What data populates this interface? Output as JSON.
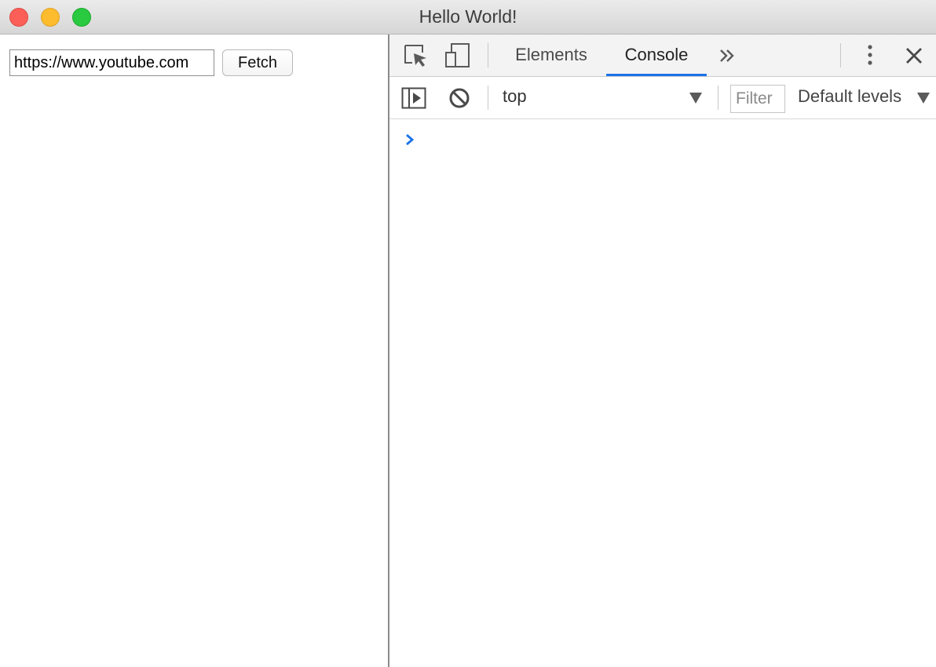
{
  "window": {
    "title": "Hello World!"
  },
  "app": {
    "url_input_value": "https://www.youtube.com",
    "fetch_button_label": "Fetch"
  },
  "devtools": {
    "tabs": [
      {
        "label": "Elements"
      },
      {
        "label": "Console",
        "active": true
      }
    ],
    "more_tabs_label": "»",
    "console_toolbar": {
      "context": "top",
      "filter_placeholder": "Filter",
      "levels": "Default levels"
    },
    "prompt_symbol": "›"
  },
  "colors": {
    "close": "#fc5f57",
    "minimize": "#fdbc2e",
    "maximize": "#29c940",
    "active_tab_underline": "#1a73e8",
    "prompt": "#1a73e8"
  },
  "icons": [
    "inspect-element-icon",
    "device-toggle-icon",
    "more-tabs-icon",
    "kebab-menu-icon",
    "close-icon",
    "sidebar-toggle-icon",
    "clear-console-icon",
    "dropdown-arrow-icon"
  ]
}
